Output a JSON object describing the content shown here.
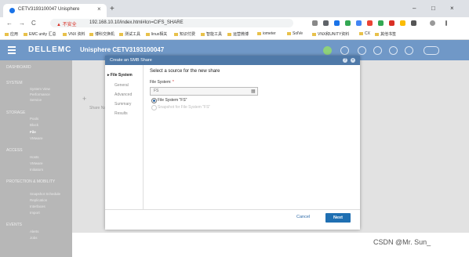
{
  "browser": {
    "tab_title": "CETV3193100047 Unisphere",
    "tab_close": "×",
    "new_tab": "+",
    "window_buttons": [
      "–",
      "□",
      "×"
    ],
    "nav_buttons": [
      "←",
      "→",
      "C"
    ],
    "insecure_label": "▲ 不安全",
    "url": "192.168.10.10/index.html#lcn=CIFS_SHARE",
    "bookmarks": [
      "应用",
      "EMC unity 汇总",
      "VNX 资料",
      "博科交换机",
      "测试工具",
      "linux相关",
      "知识付费",
      "智能工具",
      "运营微博",
      "iometer",
      "SolVe",
      "VNX和UNITY资料",
      "CX",
      "其他书签"
    ]
  },
  "app": {
    "logo": "DELLEMC",
    "title": "Unisphere CETV3193100047",
    "sidebar": [
      {
        "label": "DASHBOARD",
        "subs": []
      },
      {
        "label": "SYSTEM",
        "subs": [
          "System View",
          "Performance",
          "Service"
        ]
      },
      {
        "label": "STORAGE",
        "subs": [
          "Pools",
          "Block",
          "File",
          "VMware"
        ]
      },
      {
        "label": "ACCESS",
        "subs": [
          "Hosts",
          "VMware",
          "Initiators"
        ]
      },
      {
        "label": "PROTECTION & MOBILITY",
        "subs": [
          "Snapshot Schedule",
          "Replication",
          "Interfaces",
          "Import"
        ]
      },
      {
        "label": "EVENTS",
        "subs": [
          "Alerts",
          "Jobs"
        ]
      }
    ],
    "bg_add": "+",
    "bg_share_label": "Share Na"
  },
  "dialog": {
    "title": "Create an SMB Share",
    "steps": [
      "File System",
      "General",
      "Advanced",
      "Summary",
      "Results"
    ],
    "active_step_marker": "▸",
    "heading": "Select a source for the new share",
    "fs_label": "File System:",
    "fs_required": "*",
    "fs_value": "FS",
    "options": [
      {
        "label": "File System \"FS\"",
        "selected": true,
        "enabled": true
      },
      {
        "label": "Snapshot for File System \"FS\"",
        "selected": false,
        "enabled": false
      }
    ],
    "cancel_label": "Cancel",
    "next_label": "Next"
  },
  "watermark": "CSDN @Mr. Sun_"
}
